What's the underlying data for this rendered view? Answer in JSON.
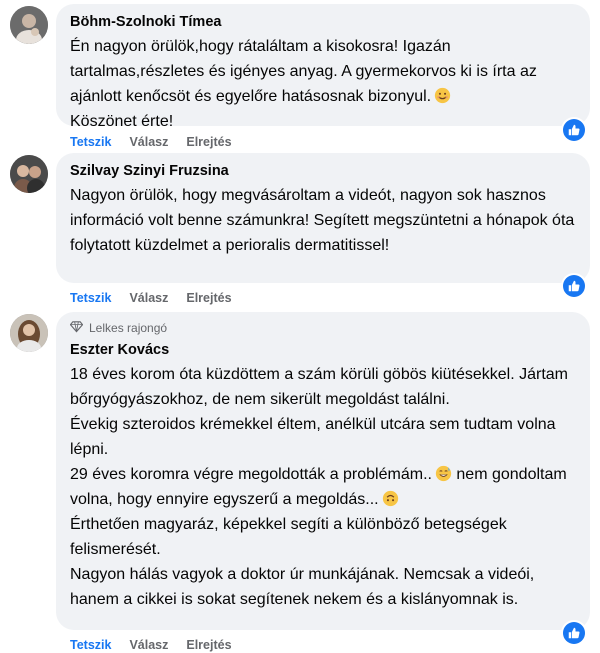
{
  "comments": [
    {
      "author": "Böhm-Szolnoki Tímea",
      "badge": "",
      "lines": [
        "Én nagyon örülök,hogy rátaláltam a kisokosra! Igazán tartalmas,részletes és igényes anyag. A gyermekorvos ki is írta az ajánlott kenőcsöt és egyelőre hatásosnak bizonyul.",
        "Köszönet érte!"
      ],
      "actions": {
        "like": "Tetszik",
        "reply": "Válasz",
        "hide": "Elrejtés"
      },
      "reaction_icon": "thumbs-up-icon"
    },
    {
      "author": "Szilvay Szinyi Fruzsina",
      "badge": "",
      "lines": [
        "Nagyon örülök, hogy megvásároltam a videót, nagyon sok hasznos információ volt benne számunkra! Segített megszüntetni a hónapok óta folytatott küzdelmet a perioralis dermatitissel!"
      ],
      "actions": {
        "like": "Tetszik",
        "reply": "Válasz",
        "hide": "Elrejtés"
      },
      "reaction_icon": "thumbs-up-icon"
    },
    {
      "author": "Eszter Kovács",
      "badge": "Lelkes rajongó",
      "lines": [
        "18 éves korom óta küzdöttem a szám körüli göbös kiütésekkel. Jártam bőrgyógyászokhoz, de nem sikerült megoldást találni.",
        "Évekig szteroidos krémekkel éltem, anélkül utcára sem tudtam volna lépni.",
        "29 éves koromra végre megoldották a problémám..",
        "nem gondoltam volna, hogy ennyire egyszerű a megoldás...",
        "Érthetően magyaráz, képekkel segíti a különböző betegségek felismerését.",
        "Nagyon hálás vagyok a doktor úr munkájának. Nemcsak a videói, hanem a cikkei is sokat segítenek nekem és a kislányomnak is."
      ],
      "actions": {
        "like": "Tetszik",
        "reply": "Válasz",
        "hide": "Elrejtés"
      },
      "reaction_icon": "thumbs-up-icon"
    }
  ],
  "colors": {
    "bubble": "#f0f2f5",
    "accent": "#1877f2",
    "muted": "#65676b"
  }
}
